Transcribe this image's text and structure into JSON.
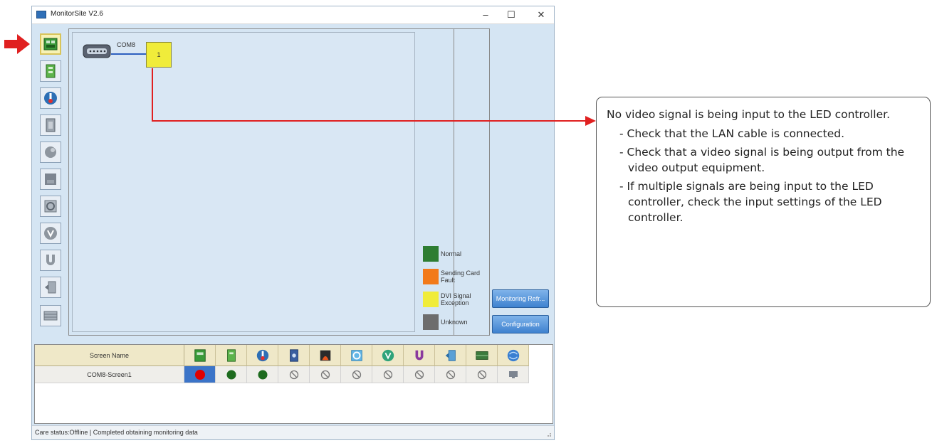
{
  "window": {
    "title": "MonitorSite V2.6",
    "controls": {
      "minimize": "–",
      "maximize": "☐",
      "close": "✕"
    }
  },
  "toolbar": {
    "items": [
      {
        "icon": "sending-card-icon",
        "active": true
      },
      {
        "icon": "receiving-card-icon"
      },
      {
        "icon": "temperature-icon"
      },
      {
        "icon": "humidity-icon"
      },
      {
        "icon": "smoke-icon"
      },
      {
        "icon": "fan-icon"
      },
      {
        "icon": "fan-speed-icon"
      },
      {
        "icon": "voltage-icon"
      },
      {
        "icon": "magnet-icon"
      },
      {
        "icon": "door-icon"
      },
      {
        "icon": "module-icon"
      }
    ]
  },
  "topology": {
    "port_label": "COM8",
    "device_label": "1"
  },
  "legend": [
    {
      "label": "Normal",
      "color": "#2e7d32"
    },
    {
      "label": "Sending Card Fault",
      "color": "#f27a1a"
    },
    {
      "label": "DVI Signal Exception",
      "color": "#f0ec3a"
    },
    {
      "label": "Unknown",
      "color": "#6d6d6d"
    }
  ],
  "side_buttons": {
    "monitoring": "Monitoring Refr...",
    "configuration": "Configuration"
  },
  "table": {
    "name_header": "Screen Name",
    "column_icons": [
      "sending-card-icon",
      "receiving-card-icon",
      "temperature-icon",
      "humidity-icon",
      "smoke-icon",
      "fan-icon",
      "voltage-icon",
      "magnet-icon",
      "door-icon",
      "module-icon",
      "network-icon"
    ],
    "rows": [
      {
        "name": "COM8-Screen1",
        "statuses": [
          "red",
          "green",
          "green",
          "disabled",
          "disabled",
          "disabled",
          "disabled",
          "disabled",
          "disabled",
          "disabled",
          "monitor"
        ]
      }
    ]
  },
  "status_bar": {
    "text": "Care status:Offline  |  Completed obtaining monitoring data"
  },
  "callout": {
    "main": "No video signal is being input to the LED controller.",
    "items": [
      "- Check that the LAN cable is connected.",
      "- Check that a video signal is being output from the video output equipment.",
      "- If multiple signals are being input to the LED controller, check the input settings of the LED controller."
    ]
  },
  "colors": {
    "indicator_red": "#e00000",
    "callout_arrow": "#e02020",
    "accent_blue": "#3b74c8"
  }
}
